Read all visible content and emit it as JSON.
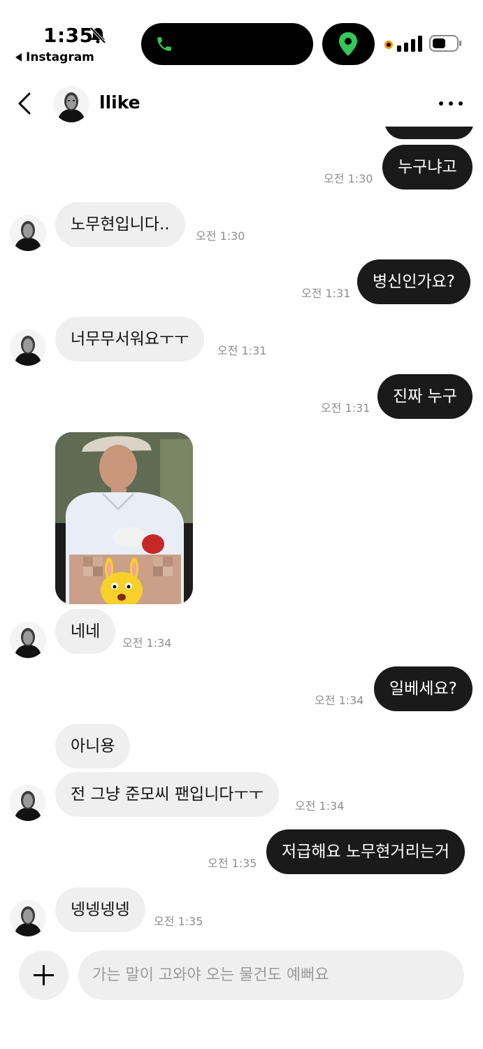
{
  "status_bar": {
    "time": "1:35",
    "back_app": "Instagram"
  },
  "header": {
    "contact_name": "llike"
  },
  "messages": [
    {
      "text": "누구냐고",
      "time": "오전 1:30"
    },
    {
      "text": "노무현입니다..",
      "time": "오전 1:30"
    },
    {
      "text": "병신인가요?",
      "time": "오전 1:31"
    },
    {
      "text": "너무무서워요ㅜㅜ",
      "time": "오전 1:31"
    },
    {
      "text": "진짜 누구",
      "time": "오전 1:31"
    },
    {
      "text": "네네",
      "time": "오전 1:34"
    },
    {
      "text": "일베세요?",
      "time": "오전 1:34"
    },
    {
      "text": "아니용",
      "time": ""
    },
    {
      "text": "전 그냥 준모씨 팬입니다ㅜㅜ",
      "time": "오전 1:34"
    },
    {
      "text": "저급해요 노무현거리는거",
      "time": "오전 1:35"
    },
    {
      "text": "넹넹넹넹",
      "time": "오전 1:35"
    }
  ],
  "composer": {
    "placeholder": "가는 말이 고와야 오는 물건도 예뻐요"
  },
  "colors": {
    "outgoing_bubble": "#1a1a1a",
    "incoming_bubble": "#efefef",
    "timestamp": "#8e8e8e",
    "location_green": "#34c759",
    "battery_orange": "#ff9500"
  }
}
